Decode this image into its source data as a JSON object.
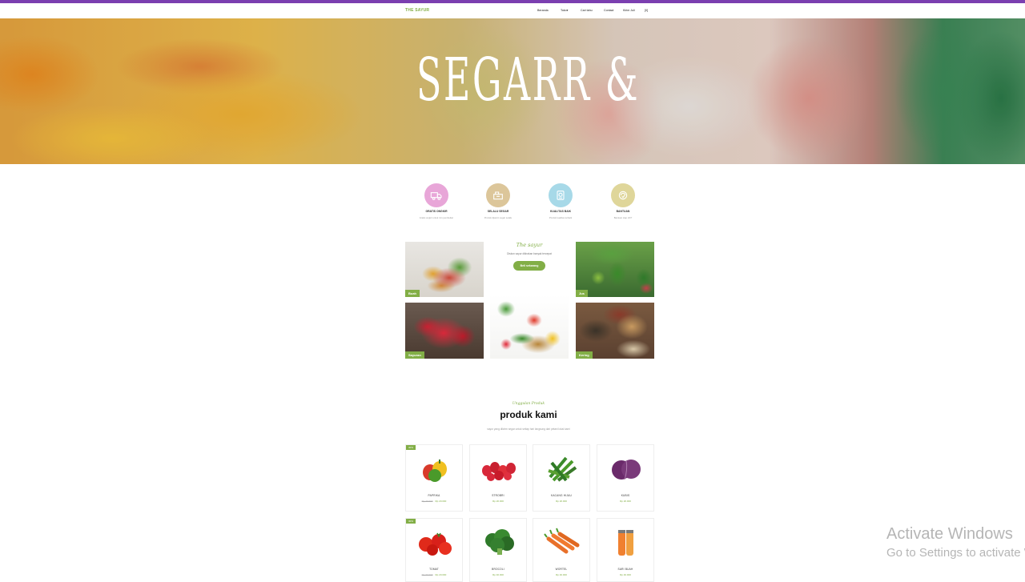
{
  "brand": "THE SAYUR",
  "nav": [
    "Beranda",
    "Toko▾",
    "Cari tahu",
    "Contact",
    "Kirim Juli",
    "[0]"
  ],
  "hero": {
    "title": "SEGARR &"
  },
  "features": [
    {
      "title": "GRATIS ONGKIR",
      "sub": "Gratis ongkir untuk min pembelian",
      "color": "#e8a6d8",
      "icon": "truck-icon"
    },
    {
      "title": "SELALU SEGAR",
      "sub": "Produk dijamin segar selalu",
      "color": "#dcc69a",
      "icon": "leaf-icon"
    },
    {
      "title": "KUALITAS BAIK",
      "sub": "Produk kualitas terbaik",
      "color": "#a7d9e8",
      "icon": "award-icon"
    },
    {
      "title": "BANTUAN",
      "sub": "Bantuan siap 24/7",
      "color": "#dfd69a",
      "icon": "support-icon"
    }
  ],
  "categories": {
    "buah": "Buah",
    "jus": "Jus",
    "sayuran": "Sayuran",
    "kering": "Kering"
  },
  "promo": {
    "title": "The sayur",
    "sub": "Diskon sayur dikirakan banyak tercepat",
    "button": "Beli sekarang"
  },
  "products_section": {
    "kicker": "Unggulan Produk",
    "title": "produk kami",
    "sub": "sayur yang dikirim segar untuk setiap hari langsung dari petani lokal kami"
  },
  "products": [
    {
      "name": "PAPRIKA",
      "old_price": "Rp 40.000",
      "price": "Rp 20.000",
      "badge": "30%"
    },
    {
      "name": "STROBRI",
      "old_price": "",
      "price": "Rp 20.000",
      "badge": ""
    },
    {
      "name": "KACANG HIJAU",
      "old_price": "",
      "price": "Rp 20.000",
      "badge": ""
    },
    {
      "name": "KUBIS",
      "old_price": "",
      "price": "Rp 20.000",
      "badge": ""
    },
    {
      "name": "TOMAT",
      "old_price": "Rp 30.000",
      "price": "Rp 20.000",
      "badge": "30%"
    },
    {
      "name": "BROCOLI",
      "old_price": "",
      "price": "Rp 40.000",
      "badge": ""
    },
    {
      "name": "WORTEL",
      "old_price": "",
      "price": "Rp 40.000",
      "badge": ""
    },
    {
      "name": "SARI BUAH",
      "old_price": "",
      "price": "Rp 40.000",
      "badge": ""
    }
  ],
  "watermark": {
    "line1": "Activate Windows",
    "line2": "Go to Settings to activate Windows."
  }
}
